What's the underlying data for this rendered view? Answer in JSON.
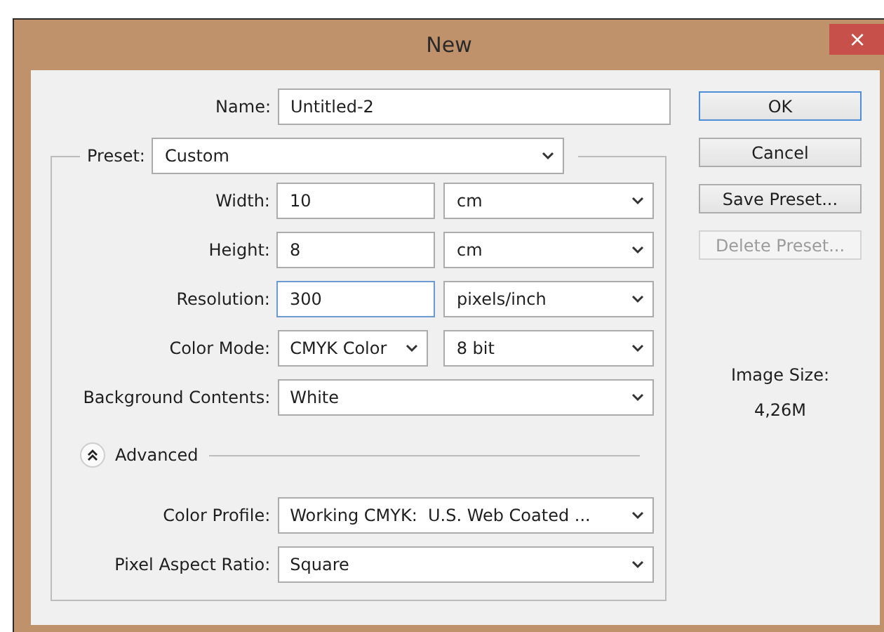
{
  "window": {
    "title": "New",
    "close": "×"
  },
  "name": {
    "label": "Name:",
    "value": "Untitled-2"
  },
  "preset": {
    "label": "Preset:",
    "value": "Custom"
  },
  "rows": [
    {
      "label": "Width:",
      "kind": "input",
      "value": "10",
      "focused": false,
      "unit": "cm"
    },
    {
      "label": "Height:",
      "kind": "input",
      "value": "8",
      "focused": false,
      "unit": "cm"
    },
    {
      "label": "Resolution:",
      "kind": "input",
      "value": "300",
      "focused": true,
      "unit": "pixels/inch"
    },
    {
      "label": "Color Mode:",
      "kind": "select",
      "value": "CMYK Color",
      "unit": "8 bit"
    },
    {
      "label": "Background Contents:",
      "kind": "wide",
      "value": "White"
    }
  ],
  "advanced": {
    "label": "Advanced",
    "expanded": true
  },
  "advanced_rows": [
    {
      "label": "Color Profile:",
      "value": "Working CMYK:  U.S. Web Coated ..."
    },
    {
      "label": "Pixel Aspect Ratio:",
      "value": "Square"
    }
  ],
  "buttons": [
    {
      "label": "OK",
      "default": true,
      "disabled": false
    },
    {
      "label": "Cancel",
      "default": false,
      "disabled": false
    },
    {
      "label": "Save Preset...",
      "default": false,
      "disabled": false
    },
    {
      "label": "Delete Preset...",
      "default": false,
      "disabled": true
    }
  ],
  "image_size": {
    "label": "Image Size:",
    "value": "4,26M"
  }
}
